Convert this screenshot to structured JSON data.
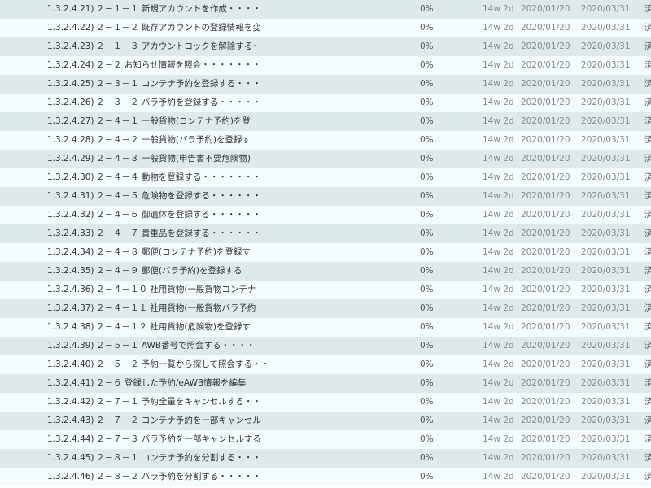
{
  "rows": [
    {
      "id": "1.3.2.4.21)",
      "name": "２－１－１ 新規アカウントを作成・・・・",
      "pct": "0%",
      "duration": "14w 2d",
      "start": "2020/01/20",
      "end": "2020/03/31",
      "extra": "済"
    },
    {
      "id": "1.3.2.4.22)",
      "name": "２－１－２ 既存アカウントの登録情報を変",
      "pct": "0%",
      "duration": "14w 2d",
      "start": "2020/01/20",
      "end": "2020/03/31",
      "extra": "済"
    },
    {
      "id": "1.3.2.4.23)",
      "name": "２－１－３ アカウントロックを解除する･",
      "pct": "0%",
      "duration": "14w 2d",
      "start": "2020/01/20",
      "end": "2020/03/31",
      "extra": "済"
    },
    {
      "id": "1.3.2.4.24)",
      "name": "２－２ お知らせ情報を照会・・・・・・・",
      "pct": "0%",
      "duration": "14w 2d",
      "start": "2020/01/20",
      "end": "2020/03/31",
      "extra": "済"
    },
    {
      "id": "1.3.2.4.25)",
      "name": "２－３－１ コンテナ予約を登録する・・・",
      "pct": "0%",
      "duration": "14w 2d",
      "start": "2020/01/20",
      "end": "2020/03/31",
      "extra": "済"
    },
    {
      "id": "1.3.2.4.26)",
      "name": "２－３－２ バラ予約を登録する・・・・・",
      "pct": "0%",
      "duration": "14w 2d",
      "start": "2020/01/20",
      "end": "2020/03/31",
      "extra": "済"
    },
    {
      "id": "1.3.2.4.27)",
      "name": "２－４－１ 一般貨物(コンテナ予約)を登",
      "pct": "0%",
      "duration": "14w 2d",
      "start": "2020/01/20",
      "end": "2020/03/31",
      "extra": "済"
    },
    {
      "id": "1.3.2.4.28)",
      "name": "２－４－２ 一般貨物(バラ予約)を登録す",
      "pct": "0%",
      "duration": "14w 2d",
      "start": "2020/01/20",
      "end": "2020/03/31",
      "extra": "済"
    },
    {
      "id": "1.3.2.4.29)",
      "name": "２－４－３ 一般貨物(申告書不要危険物)",
      "pct": "0%",
      "duration": "14w 2d",
      "start": "2020/01/20",
      "end": "2020/03/31",
      "extra": "済"
    },
    {
      "id": "1.3.2.4.30)",
      "name": "２－４－４ 動物を登録する・・・・・・・",
      "pct": "0%",
      "duration": "14w 2d",
      "start": "2020/01/20",
      "end": "2020/03/31",
      "extra": "済"
    },
    {
      "id": "1.3.2.4.31)",
      "name": "２－４－５ 危険物を登録する・・・・・・",
      "pct": "0%",
      "duration": "14w 2d",
      "start": "2020/01/20",
      "end": "2020/03/31",
      "extra": "済"
    },
    {
      "id": "1.3.2.4.32)",
      "name": "２－４－６ 御遺体を登録する・・・・・・",
      "pct": "0%",
      "duration": "14w 2d",
      "start": "2020/01/20",
      "end": "2020/03/31",
      "extra": "済"
    },
    {
      "id": "1.3.2.4.33)",
      "name": "２－４－７ 貴重品を登録する・・・・・・",
      "pct": "0%",
      "duration": "14w 2d",
      "start": "2020/01/20",
      "end": "2020/03/31",
      "extra": "済"
    },
    {
      "id": "1.3.2.4.34)",
      "name": "２－４－８ 郵便(コンテナ予約)を登録す",
      "pct": "0%",
      "duration": "14w 2d",
      "start": "2020/01/20",
      "end": "2020/03/31",
      "extra": "済"
    },
    {
      "id": "1.3.2.4.35)",
      "name": "２－４－９  郵便(バラ予約)を登録する",
      "pct": "0%",
      "duration": "14w 2d",
      "start": "2020/01/20",
      "end": "2020/03/31",
      "extra": "済"
    },
    {
      "id": "1.3.2.4.36)",
      "name": "２－４－１０ 社用貨物(一般貨物コンテナ",
      "pct": "0%",
      "duration": "14w 2d",
      "start": "2020/01/20",
      "end": "2020/03/31",
      "extra": "済"
    },
    {
      "id": "1.3.2.4.37)",
      "name": "２－４－１１ 社用貨物(一般貨物バラ予約",
      "pct": "0%",
      "duration": "14w 2d",
      "start": "2020/01/20",
      "end": "2020/03/31",
      "extra": "済"
    },
    {
      "id": "1.3.2.4.38)",
      "name": "２－４－１２ 社用貨物(危険物)を登録す",
      "pct": "0%",
      "duration": "14w 2d",
      "start": "2020/01/20",
      "end": "2020/03/31",
      "extra": "済"
    },
    {
      "id": "1.3.2.4.39)",
      "name": "２－５－１ AWB番号で照会する・・・・",
      "pct": "0%",
      "duration": "14w 2d",
      "start": "2020/01/20",
      "end": "2020/03/31",
      "extra": "済"
    },
    {
      "id": "1.3.2.4.40)",
      "name": "２－５－２ 予約一覧から探して照会する・・",
      "pct": "0%",
      "duration": "14w 2d",
      "start": "2020/01/20",
      "end": "2020/03/31",
      "extra": "済"
    },
    {
      "id": "1.3.2.4.41)",
      "name": "２－６ 登録した予約/eAWB情報を編集",
      "pct": "0%",
      "duration": "14w 2d",
      "start": "2020/01/20",
      "end": "2020/03/31",
      "extra": "済"
    },
    {
      "id": "1.3.2.4.42)",
      "name": "２－７－１ 予約全量をキャンセルする・・",
      "pct": "0%",
      "duration": "14w 2d",
      "start": "2020/01/20",
      "end": "2020/03/31",
      "extra": "済"
    },
    {
      "id": "1.3.2.4.43)",
      "name": "２－７－２ コンテナ予約を一部キャンセル",
      "pct": "0%",
      "duration": "14w 2d",
      "start": "2020/01/20",
      "end": "2020/03/31",
      "extra": "済"
    },
    {
      "id": "1.3.2.4.44)",
      "name": "２－７－３ バラ予約を一部キャンセルする",
      "pct": "0%",
      "duration": "14w 2d",
      "start": "2020/01/20",
      "end": "2020/03/31",
      "extra": "済"
    },
    {
      "id": "1.3.2.4.45)",
      "name": "２－８－１ コンテナ予約を分割する・・・",
      "pct": "0%",
      "duration": "14w 2d",
      "start": "2020/01/20",
      "end": "2020/03/31",
      "extra": "済"
    },
    {
      "id": "1.3.2.4.46)",
      "name": "２－８－２ バラ予約を分割する・・・・・",
      "pct": "0%",
      "duration": "14w 2d",
      "start": "2020/01/20",
      "end": "2020/03/31",
      "extra": "済"
    }
  ]
}
